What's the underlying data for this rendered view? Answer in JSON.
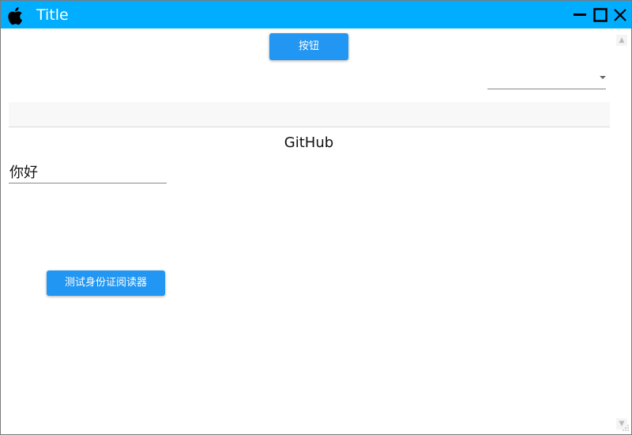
{
  "window": {
    "title": "Title",
    "titlebar_color": "#00adff",
    "app_icon": "apple-icon",
    "controls": [
      "minimize-icon",
      "maximize-icon",
      "close-icon"
    ]
  },
  "main": {
    "top_button_label": "按钮",
    "dropdown_selected": "",
    "text_bar_value": "",
    "link_text": "GitHub",
    "hello_input_value": "你好",
    "id_reader_button_label": "测试身份证阅读器",
    "accent_color": "#2196f3"
  },
  "scrollbar": {
    "up_glyph": "▲",
    "down_glyph": "▼"
  }
}
